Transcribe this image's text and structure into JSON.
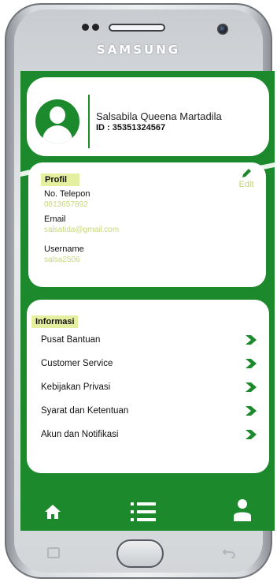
{
  "device": {
    "brand": "SAMSUNG"
  },
  "profile": {
    "name": "Salsabila Queena Martadila",
    "id": "ID : 35351324567",
    "section_title": "Profil",
    "edit_label": "Edit",
    "fields": [
      {
        "label": "No. Telepon",
        "value": "0813657892"
      },
      {
        "label": "Email",
        "value": "salsatida@gmail.com"
      },
      {
        "label": "Username",
        "value": "salsa2506"
      }
    ]
  },
  "info": {
    "section_title": "Informasi",
    "items": [
      {
        "label": "Pusat Bantuan"
      },
      {
        "label": "Customer Service"
      },
      {
        "label": "Kebijakan Privasi"
      },
      {
        "label": "Syarat dan Ketentuan"
      },
      {
        "label": "Akun dan Notifikasi"
      }
    ]
  },
  "bottom_nav": [
    {
      "icon": "home-icon"
    },
    {
      "icon": "list-icon"
    },
    {
      "icon": "user-icon"
    }
  ],
  "colors": {
    "primary": "#1c8a2c",
    "accent": "#e4ef9f",
    "value_text": "#c8d77a"
  }
}
